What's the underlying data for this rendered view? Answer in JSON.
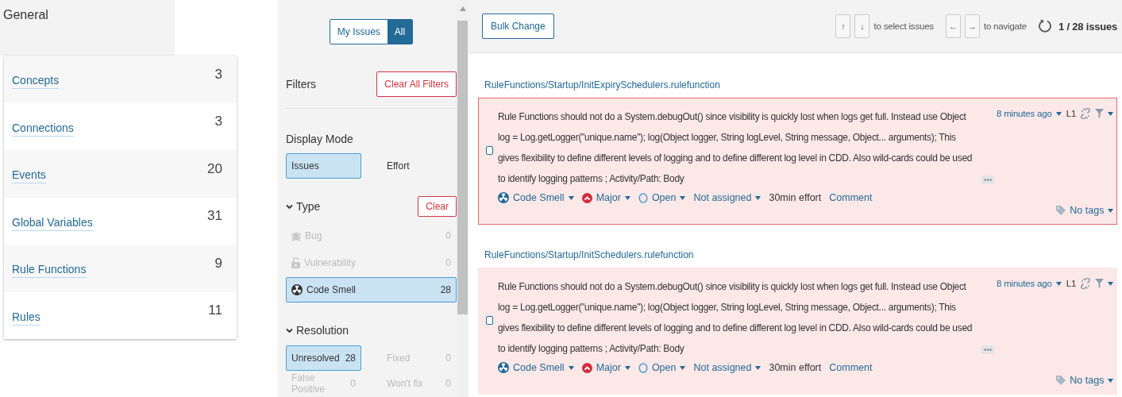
{
  "general": {
    "title": "General",
    "items": [
      {
        "label": "Concepts",
        "count": "3"
      },
      {
        "label": "Connections",
        "count": "3"
      },
      {
        "label": "Events",
        "count": "20"
      },
      {
        "label": "Global Variables",
        "count": "31"
      },
      {
        "label": "Rule Functions",
        "count": "9"
      },
      {
        "label": "Rules",
        "count": "11"
      }
    ]
  },
  "filters": {
    "toggle": [
      {
        "label": "My Issues",
        "selected": false
      },
      {
        "label": "All",
        "selected": true
      }
    ],
    "title": "Filters",
    "clear_all": "Clear All Filters",
    "display_mode": {
      "title": "Display Mode",
      "options": [
        {
          "label": "Issues",
          "selected": true
        },
        {
          "label": "Effort",
          "selected": false
        }
      ]
    },
    "sections": [
      {
        "title": "Type",
        "expanded": true,
        "clear": "Clear",
        "items": [
          {
            "kind": "bug",
            "label": "Bug",
            "count": "0",
            "selected": false,
            "disabled": true
          },
          {
            "kind": "vulnerability",
            "label": "Vulnerability",
            "count": "0",
            "selected": false,
            "disabled": true
          },
          {
            "kind": "code_smell",
            "label": "Code Smell",
            "count": "28",
            "selected": true,
            "disabled": false
          }
        ]
      },
      {
        "title": "Resolution",
        "expanded": true,
        "items": [
          {
            "label": "Unresolved",
            "count": "28",
            "selected": true,
            "disabled": false
          },
          {
            "label": "Fixed",
            "count": "0",
            "selected": false,
            "disabled": true
          },
          {
            "label": "False Positive",
            "count": "0",
            "selected": false,
            "disabled": true
          },
          {
            "label": "Won't fix",
            "count": "0",
            "selected": false,
            "disabled": true
          }
        ]
      }
    ]
  },
  "toolbar": {
    "bulk_change": "Bulk Change",
    "select_keys": [
      "↑",
      "↓"
    ],
    "select_hint": "to select issues",
    "nav_keys": [
      "←",
      "→"
    ],
    "nav_hint": "to navigate",
    "counter": "1 / 28 issues"
  },
  "issues": [
    {
      "path": "RuleFunctions/Startup/InitExpirySchedulers.rulefunction",
      "selected": true,
      "checked": false,
      "message": "Rule Functions should not do a System.debugOut() since visibility is quickly lost when logs get full. Instead use Object log = Log.getLogger(\"unique.name\"); log(Object logger, String logLevel, String message, Object... arguments); This gives flexibility to define different levels of logging and to define different log level in CDD. Also wild-cards could be used to identify logging patterns ; Activity/Path: Body",
      "time": "8 minutes ago",
      "line": "L1",
      "type": "Code Smell",
      "severity": "Major",
      "status": "Open",
      "assignee": "Not assigned",
      "effort": "30min effort",
      "comment": "Comment",
      "tags": "No tags"
    },
    {
      "path": "RuleFunctions/Startup/InitSchedulers.rulefunction",
      "selected": false,
      "checked": false,
      "message": "Rule Functions should not do a System.debugOut() since visibility is quickly lost when logs get full. Instead use Object log = Log.getLogger(\"unique.name\"); log(Object logger, String logLevel, String message, Object... arguments); This gives flexibility to define different levels of logging and to define different log level in CDD. Also wild-cards could be used to identify logging patterns ; Activity/Path: Body",
      "time": "8 minutes ago",
      "line": "L1",
      "type": "Code Smell",
      "severity": "Major",
      "status": "Open",
      "assignee": "Not assigned",
      "effort": "30min effort",
      "comment": "Comment",
      "tags": "No tags"
    }
  ]
}
